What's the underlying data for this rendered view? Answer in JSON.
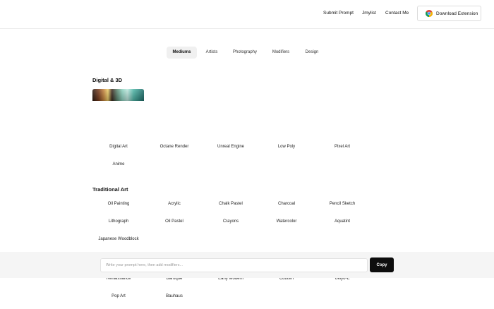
{
  "header": {
    "nav": [
      "Submit Prompt",
      "Jmylist",
      "Contact Me"
    ],
    "extension_button": {
      "label": "Download Extension",
      "icon": "chrome-icon"
    }
  },
  "tabs": [
    {
      "label": "Mediums",
      "active": true
    },
    {
      "label": "Artists",
      "active": false
    },
    {
      "label": "Photography",
      "active": false
    },
    {
      "label": "Modifiers",
      "active": false
    },
    {
      "label": "Design",
      "active": false
    }
  ],
  "sections": {
    "digital": {
      "title": "Digital & 3D",
      "items": [
        "Digital Art",
        "Octane Render",
        "Unreal Engine",
        "Low Poly",
        "Pixel Art",
        "Anime"
      ]
    },
    "traditional": {
      "title": "Traditional Art",
      "items": [
        "Oil Painting",
        "Acrylic",
        "Chalk Pastel",
        "Charcoal",
        "Pencil Sketch",
        "Lithograph",
        "Oil Pastel",
        "Crayons",
        "Watercolor",
        "Aquatint",
        "Japanese Woodblock"
      ]
    },
    "movements": {
      "items": [
        "Renaissance",
        "Baroque",
        "Early Modern",
        "Cubism",
        "Ukiyo-E",
        "Pop Art",
        "Bauhaus"
      ]
    }
  },
  "prompt": {
    "placeholder": "Write your prompt here, then add modifiers...",
    "value": "",
    "copy_label": "Copy"
  }
}
